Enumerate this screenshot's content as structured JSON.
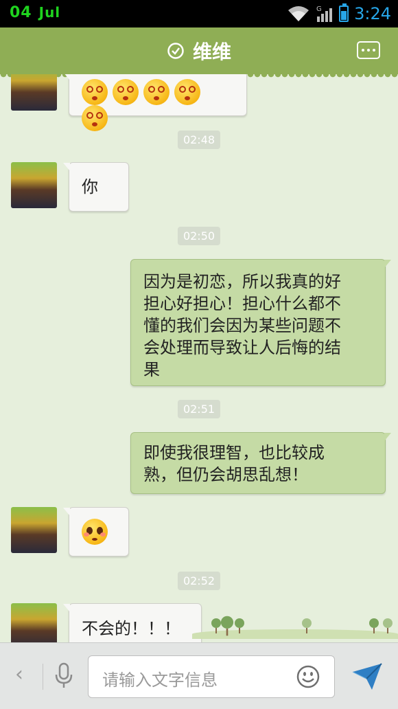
{
  "status_bar": {
    "day": "04",
    "month": "Jul",
    "time": "3:24",
    "network": "G"
  },
  "header": {
    "title": "维维"
  },
  "messages": [
    {
      "side": "left",
      "kind": "emoji",
      "emoji": [
        "dizzy-face",
        "dizzy-face",
        "dizzy-face",
        "dizzy-face",
        "dizzy-face"
      ]
    },
    {
      "kind": "time",
      "text": "02:48"
    },
    {
      "side": "left",
      "kind": "text",
      "text": "你"
    },
    {
      "kind": "time",
      "text": "02:50"
    },
    {
      "side": "right",
      "kind": "text",
      "lines": [
        "因为是初恋，所以我真的好",
        "担心好担心！担心什么都不",
        "懂的我们会因为某些问题不",
        "会处理而导致让人后悔的结",
        "果"
      ]
    },
    {
      "kind": "time",
      "text": "02:51"
    },
    {
      "side": "right",
      "kind": "text",
      "lines": [
        "即使我很理智，也比较成",
        "熟，但仍会胡思乱想！"
      ]
    },
    {
      "side": "left",
      "kind": "emoji",
      "emoji": [
        "pleading-face"
      ]
    },
    {
      "kind": "time",
      "text": "02:52"
    },
    {
      "side": "left",
      "kind": "text",
      "text": "不会的！！！"
    }
  ],
  "input": {
    "placeholder": "请输入文字信息"
  },
  "colors": {
    "title_bar": "#8fae55",
    "chat_bg": "#e6efdc",
    "right_bubble": "#c5dba5",
    "left_bubble": "#f7f7f5",
    "time_accent": "#27a6e8"
  }
}
